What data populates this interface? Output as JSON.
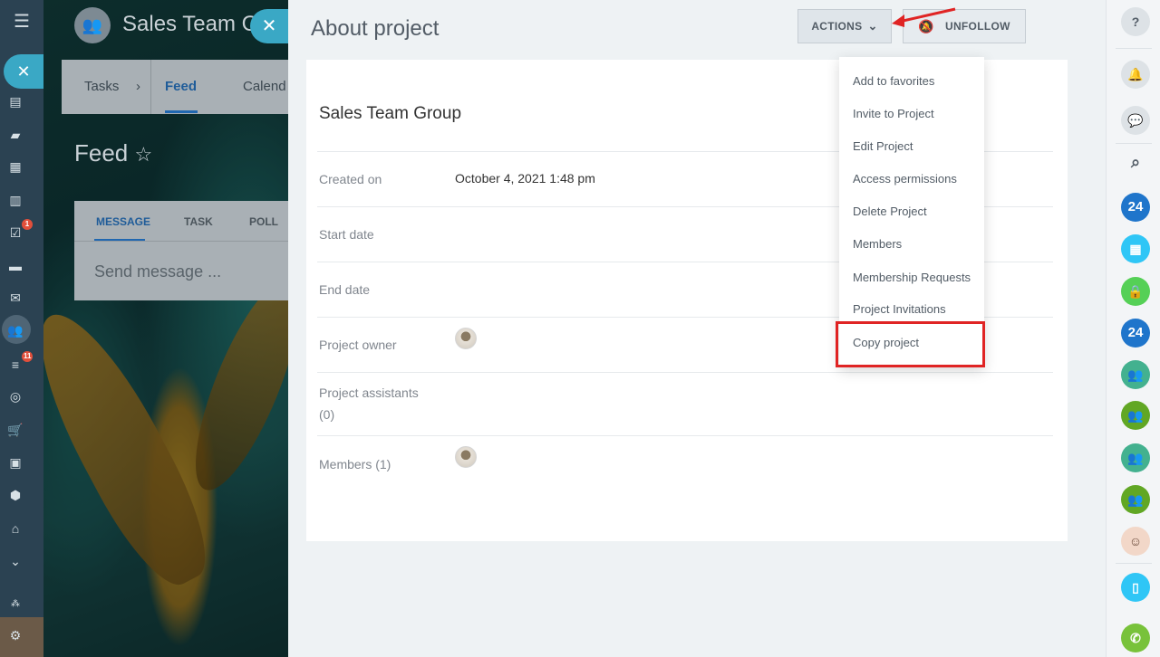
{
  "left_nav": {
    "menu_icon": "hamburger-icon",
    "badges": {
      "tasks": "1",
      "filters": "11"
    }
  },
  "background": {
    "group_title": "Sales Team G",
    "tabs": [
      "Tasks",
      "Feed",
      "Calend"
    ],
    "tab_separator": "›",
    "active_tab": "Feed",
    "feed_title": "Feed",
    "post_tabs": [
      "MESSAGE",
      "TASK",
      "POLL"
    ],
    "send_placeholder": "Send message ..."
  },
  "panel": {
    "title": "About project",
    "actions_label": "ACTIONS",
    "unfollow_label": "UNFOLLOW",
    "project_name": "Sales Team Group",
    "fields": [
      {
        "label": "Created on",
        "value": "October 4, 2021 1:48 pm"
      },
      {
        "label": "Start date",
        "value": ""
      },
      {
        "label": "End date",
        "value": ""
      },
      {
        "label": "Project owner",
        "value": ""
      },
      {
        "label": "Project assistants",
        "value": "(0)"
      },
      {
        "label": "Members (1)",
        "value": ""
      }
    ]
  },
  "actions_menu": {
    "items": [
      "Add to favorites",
      "Invite to Project",
      "Edit Project",
      "Access permissions",
      "Delete Project",
      "Members",
      "Membership Requests",
      "Project Invitations",
      "Copy project"
    ],
    "highlighted": "Copy project",
    "highlight_color": "#e02424"
  },
  "right_bar": {
    "help": "?",
    "b24": "24"
  },
  "colors": {
    "accent": "#2067b0",
    "slider_button": "#3aa8c5",
    "nav_bg": "#2b4252"
  }
}
